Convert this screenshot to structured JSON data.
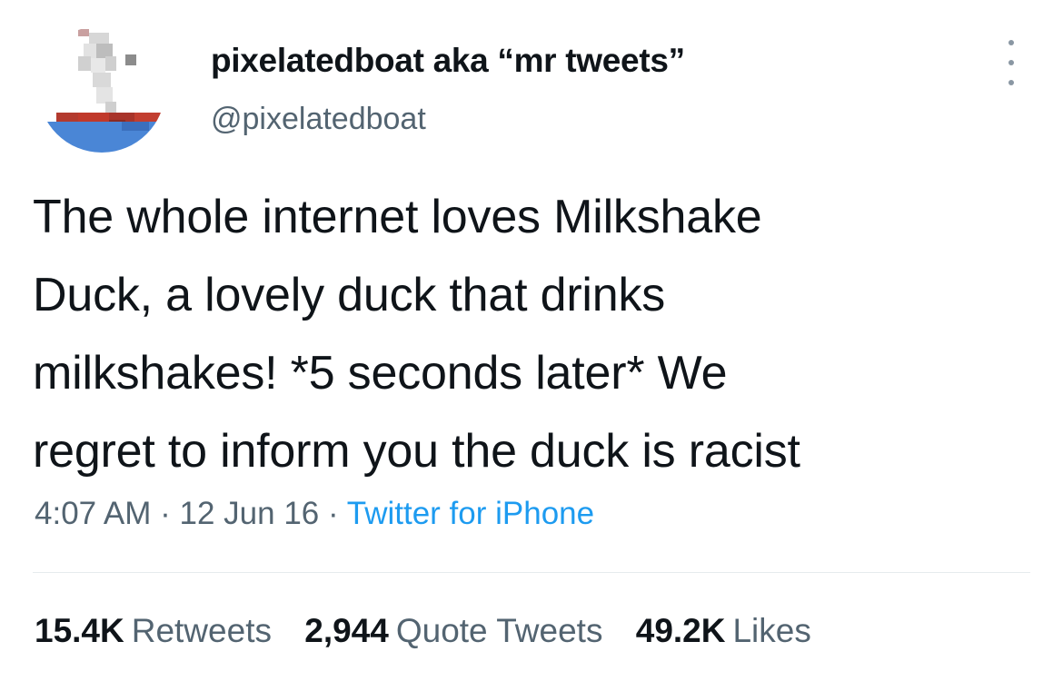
{
  "user": {
    "display_name": "pixelatedboat aka “mr tweets”",
    "handle": "@pixelatedboat",
    "avatar_icon": "pixel-boat-avatar"
  },
  "tweet": {
    "lines": [
      "The whole internet loves Milkshake",
      "Duck, a lovely duck that drinks",
      "milkshakes! *5 seconds later* We",
      "regret to inform you the duck is racist"
    ]
  },
  "meta": {
    "time": "4:07 AM",
    "separator": " · ",
    "date": "12 Jun 16",
    "source": "Twitter for iPhone"
  },
  "stats": {
    "retweets_count": "15.4K",
    "retweets_label": "Retweets",
    "quotes_count": "2,944",
    "quotes_label": "Quote Tweets",
    "likes_count": "49.2K",
    "likes_label": "Likes"
  },
  "colors": {
    "text": "#0f1419",
    "secondary": "#536471",
    "link": "#1d9bf0",
    "avatar_sea": "#4a86d6",
    "avatar_hull": "#c0392b"
  }
}
